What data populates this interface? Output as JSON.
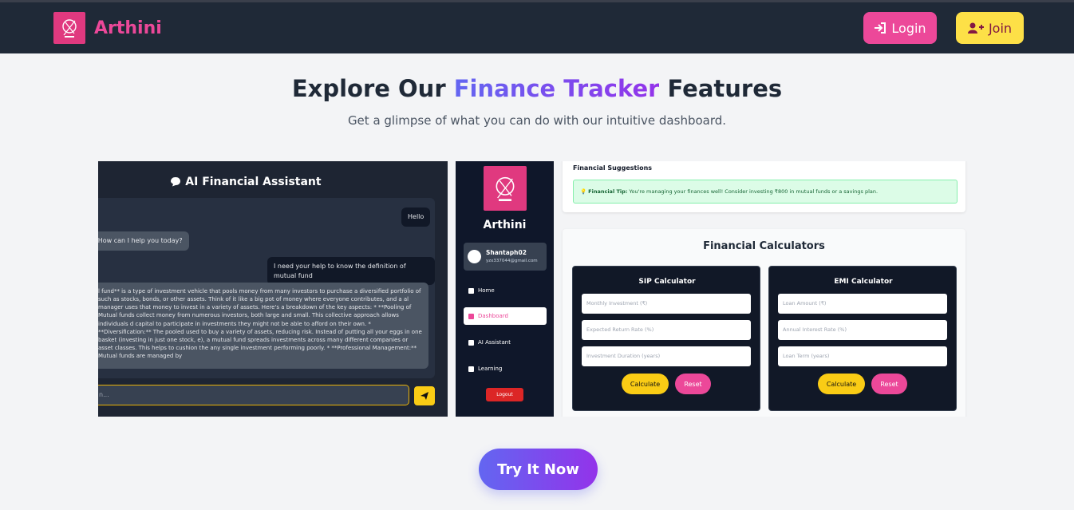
{
  "header": {
    "brand_name": "Arthini",
    "login_label": "Login",
    "join_label": "Join"
  },
  "hero": {
    "title_before": "Explore Our ",
    "title_accent": "Finance Tracker",
    "title_after": " Features",
    "subtitle": "Get a glimpse of what you can do with our intuitive dashboard."
  },
  "chat": {
    "title": "AI Financial Assistant",
    "messages": [
      {
        "role": "user",
        "text": "Hello"
      },
      {
        "role": "bot",
        "text": "! How can I help you today?"
      },
      {
        "role": "user",
        "text": "I need your help to know the definition of mutual fund"
      },
      {
        "role": "bot",
        "text": "l fund** is a type of investment vehicle that pools money from many investors to purchase a diversified portfolio of such as stocks, bonds, or other assets. Think of it like a big pot of money where everyone contributes, and a al manager uses that money to invest in a variety of assets. Here's a breakdown of the key aspects: * **Pooling of Mutual funds collect money from numerous investors, both large and small. This collective approach allows individuals d capital to participate in investments they might not be able to afford on their own. * **Diversification:** The pooled used to buy a variety of assets, reducing risk. Instead of putting all your eggs in one basket (investing in just one stock, e), a mutual fund spreads investments across many different companies or asset classes. This helps to cushion the any single investment performing poorly. * **Professional Management:** Mutual funds are managed by"
      }
    ],
    "input_placeholder": "n..."
  },
  "sidebar": {
    "brand": "Arthini",
    "username": "Shantaph02",
    "email": "yzx337044@gmail.com",
    "items": [
      {
        "label": "Home",
        "active": false
      },
      {
        "label": "Dashboard",
        "active": true
      },
      {
        "label": "AI Assistant",
        "active": false
      },
      {
        "label": "Learning",
        "active": false
      }
    ],
    "logout_label": "Logout"
  },
  "dashboard": {
    "suggestions_title": "Financial Suggestions",
    "tip_label": "Financial Tip:",
    "tip_text": " You're managing your finances well! Consider investing ₹800 in mutual funds or a savings plan.",
    "calculators_title": "Financial Calculators",
    "sip": {
      "title": "SIP Calculator",
      "fields": [
        "Monthly Investment (₹)",
        "Expected Return Rate (%)",
        "Investment Duration (years)"
      ],
      "calculate": "Calculate",
      "reset": "Reset"
    },
    "emi": {
      "title": "EMI Calculator",
      "fields": [
        "Loan Amount (₹)",
        "Annual Interest Rate (%)",
        "Loan Term (years)"
      ],
      "calculate": "Calculate",
      "reset": "Reset"
    }
  },
  "cta": {
    "label": "Try It Now"
  },
  "colors": {
    "brand_pink": "#ec4899",
    "join_yellow": "#fde047",
    "accent_start": "#6366f1",
    "accent_end": "#9333ea",
    "header_bg": "#1f2937"
  }
}
